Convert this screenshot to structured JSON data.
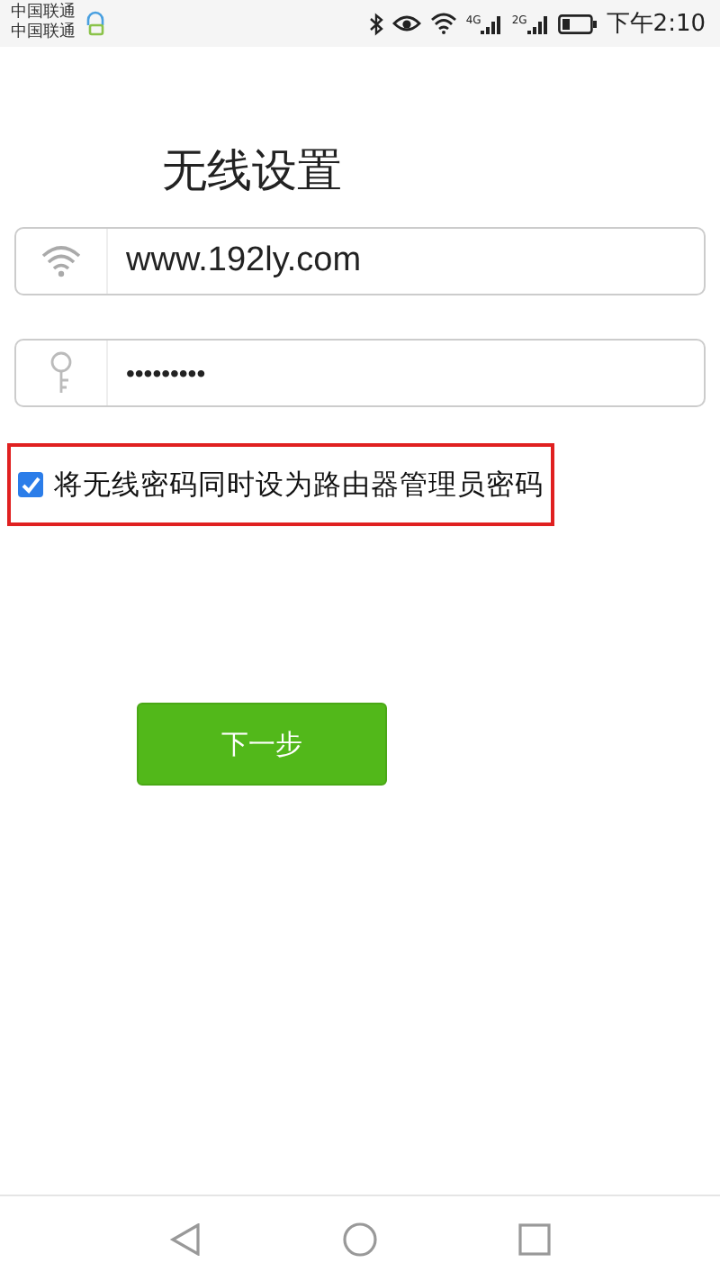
{
  "status_bar": {
    "carriers": [
      "中国联通",
      "中国联通"
    ],
    "network_labels": [
      "4G",
      "2G"
    ],
    "time": "下午2:10"
  },
  "title": "无线设置",
  "fields": [
    {
      "kind": "wifi",
      "value": "www.192ly.com"
    },
    {
      "kind": "key",
      "value": "•••••••••"
    }
  ],
  "option": {
    "label": "将无线密码同时设为路由器管理员密码",
    "checked": true,
    "highlighted": true
  },
  "next_button": "下一步"
}
